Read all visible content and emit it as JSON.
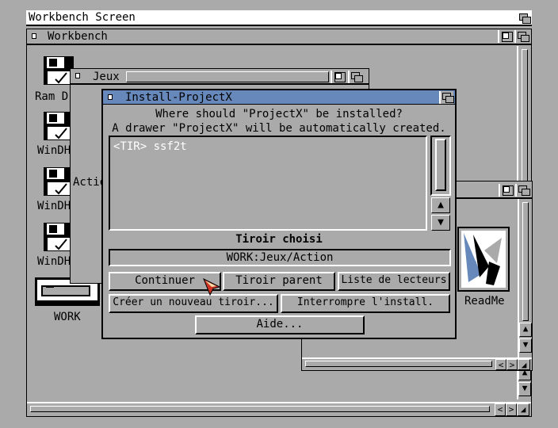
{
  "screen": {
    "title": "Workbench Screen"
  },
  "workbench_window": {
    "title": "Workbench"
  },
  "jeux_window": {
    "title": "Jeux",
    "partial_label": "Actio"
  },
  "icons": [
    {
      "label": "Ram D",
      "icon": "floppy-disk-icon"
    },
    {
      "label": "WinDH",
      "icon": "floppy-disk-icon"
    },
    {
      "label": "WinDH",
      "icon": "floppy-disk-icon"
    },
    {
      "label": "WinDH",
      "icon": "floppy-disk-icon"
    },
    {
      "label": "WORK",
      "icon": "hard-drive-icon"
    },
    {
      "label": "ReadMe",
      "icon": "readme-icon"
    }
  ],
  "dialog": {
    "title": "Install-ProjectX",
    "question": "Where should \"ProjectX\" be installed?",
    "note": "A drawer \"ProjectX\" will be automatically created.",
    "list_items": [
      "<TIR> ssf2t"
    ],
    "chosen_label": "Tiroir choisi",
    "chosen_value": "WORK:Jeux/Action",
    "buttons": {
      "continue": "Continuer",
      "parent": "Tiroir parent",
      "drives": "Liste de lecteurs",
      "new_drawer": "Créer un nouveau tiroir...",
      "abort": "Interrompre l'install.",
      "help": "Aide..."
    }
  },
  "colors": {
    "blue": "#6688bb",
    "grey": "#aaaaaa",
    "white": "#ffffff",
    "black": "#000000",
    "pointer": "#cc3322"
  }
}
